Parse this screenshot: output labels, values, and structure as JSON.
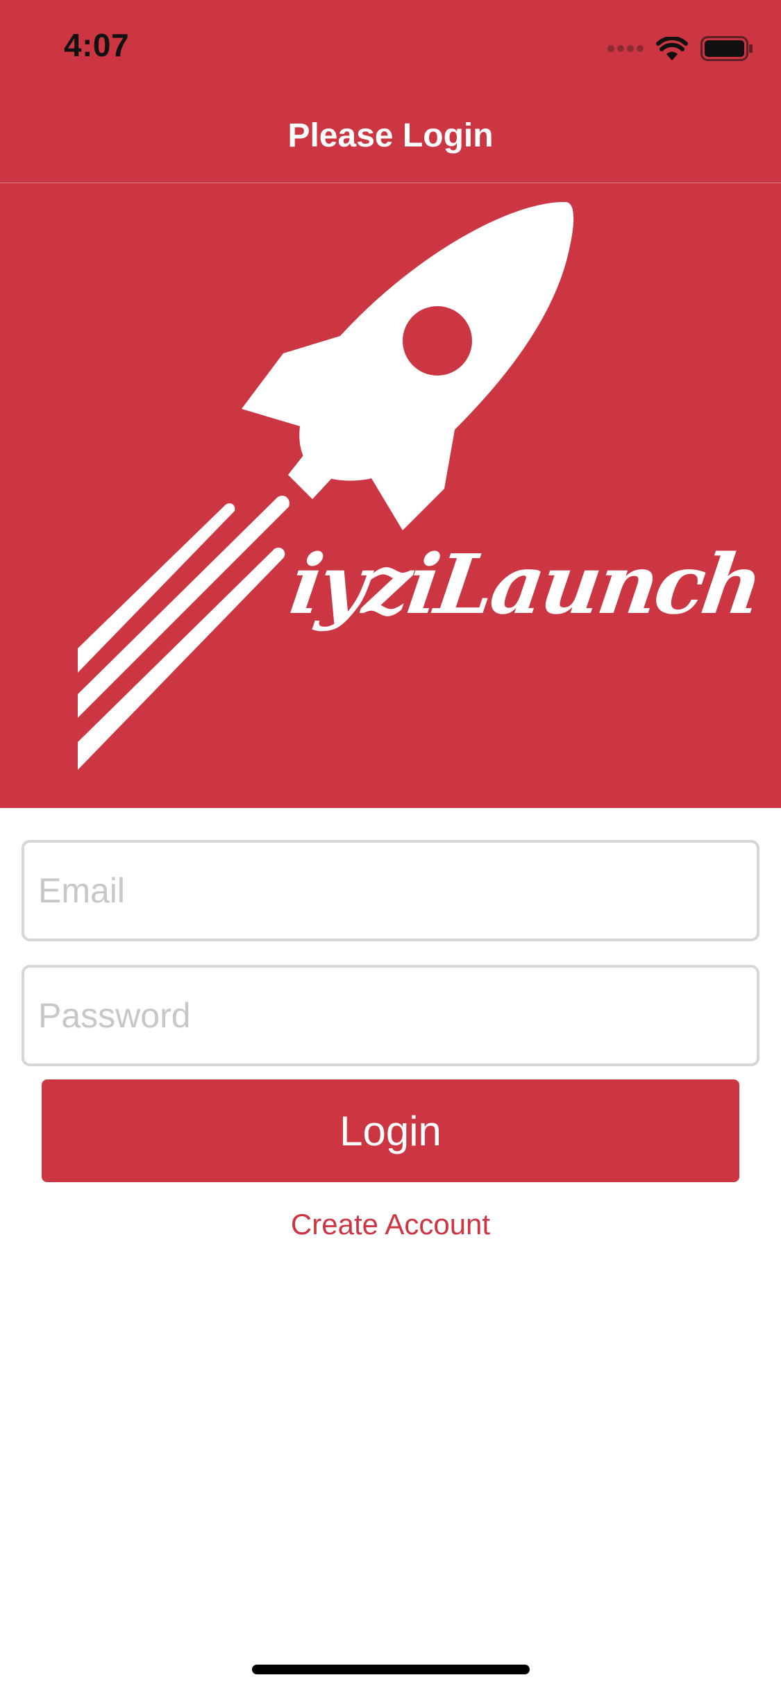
{
  "status_bar": {
    "time": "4:07",
    "signal_icon": "cellular-signal-icon",
    "wifi_icon": "wifi-icon",
    "battery_icon": "battery-icon"
  },
  "nav": {
    "title": "Please Login"
  },
  "hero": {
    "logo_icon": "rocket-logo-icon",
    "brand_name": "iyziLaunch"
  },
  "form": {
    "email_placeholder": "Email",
    "email_value": "",
    "password_placeholder": "Password",
    "password_value": "",
    "login_label": "Login",
    "create_account_label": "Create Account"
  },
  "colors": {
    "brand": "#CC3642",
    "field_border": "#D6D6D6",
    "placeholder": "#C6C6CB"
  }
}
